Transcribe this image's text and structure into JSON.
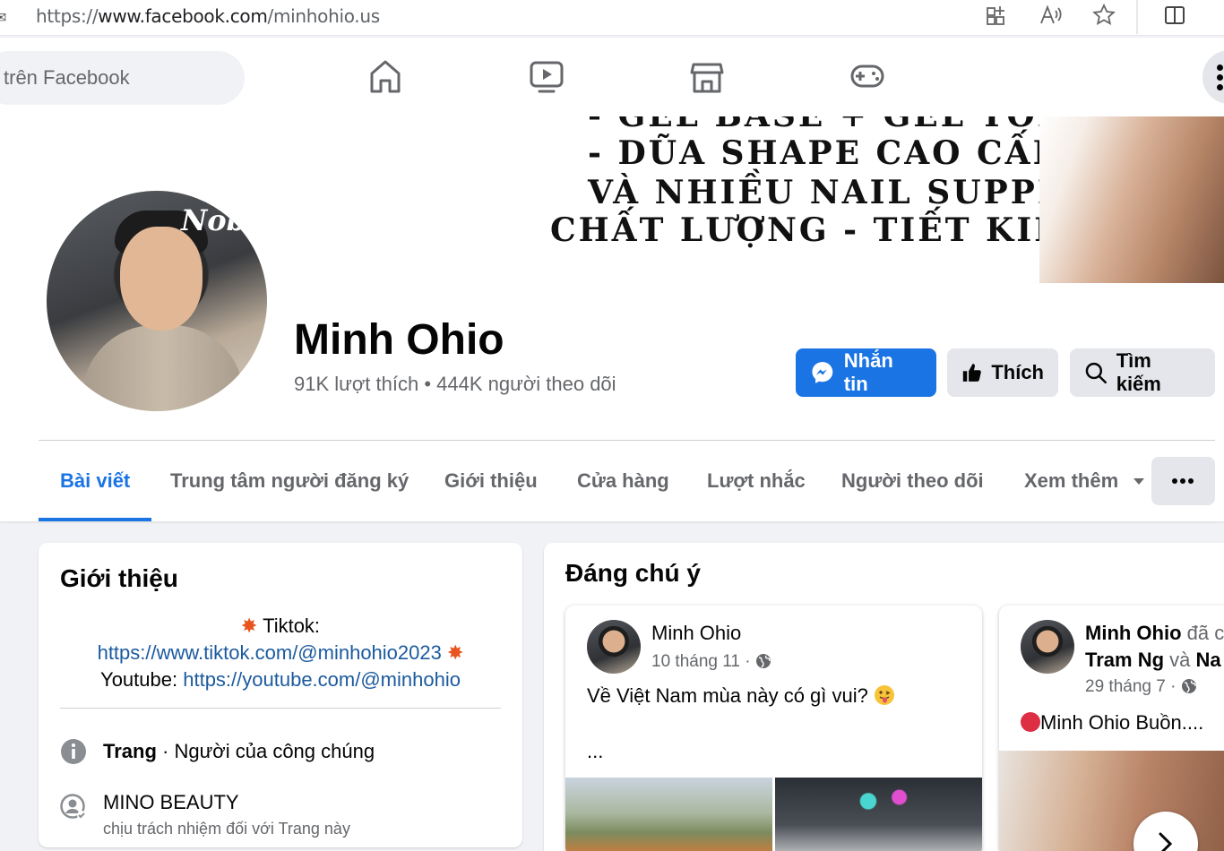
{
  "browser": {
    "url_prefix": "https://",
    "url_domain": "www.facebook.com",
    "url_path": "/minhohio.us"
  },
  "nav": {
    "search_placeholder": "trên Facebook",
    "icons": [
      "home-icon",
      "video-icon",
      "marketplace-icon",
      "gaming-icon"
    ]
  },
  "cover": {
    "lines": [
      "- GEL BASE + GEL TOP",
      "- DŨA SHAPE CAO CẤP",
      "VÀ NHIỀU NAIL SUPPLY",
      "CHẤT LƯỢNG - TIẾT KIỆM"
    ]
  },
  "profile": {
    "name": "Minh Ohio",
    "stats": "91K lượt thích • 444K người theo dõi",
    "avatar_tag": "Nobi",
    "buttons": {
      "message": "Nhắn tin",
      "like": "Thích",
      "search": "Tìm kiếm"
    }
  },
  "tabs": [
    {
      "label": "Bài viết",
      "active": true
    },
    {
      "label": "Trung tâm người đăng ký",
      "active": false
    },
    {
      "label": "Giới thiệu",
      "active": false
    },
    {
      "label": "Cửa hàng",
      "active": false
    },
    {
      "label": "Lượt nhắc",
      "active": false
    },
    {
      "label": "Người theo dõi",
      "active": false
    },
    {
      "label": "Xem thêm",
      "active": false
    }
  ],
  "intro": {
    "title": "Giới thiệu",
    "bio_tiktok_label": "Tiktok:",
    "bio_tiktok_url": "https://www.tiktok.com/@minhohio2023",
    "bio_youtube_label": "Youtube:",
    "bio_youtube_url": "https://youtube.com/@minhohio",
    "page_type_bold": "Trang",
    "page_type_rest": " · Người của công chúng",
    "owner_name": "MINO BEAUTY",
    "owner_note": "chịu trách nhiệm đối với Trang này"
  },
  "featured": {
    "title": "Đáng chú ý",
    "posts": [
      {
        "author": "Minh Ohio",
        "date": "10 tháng 11 ·",
        "text": "Về Việt Nam mùa này có gì vui?",
        "more": "..."
      },
      {
        "author": "Minh Ohio",
        "author_suffix": " đã c",
        "line2_a": "Tram Ng",
        "line2_b": " và ",
        "line2_c": "Na",
        "date": "29 tháng 7 ·",
        "text": "Minh Ohio Buồn...."
      }
    ]
  }
}
